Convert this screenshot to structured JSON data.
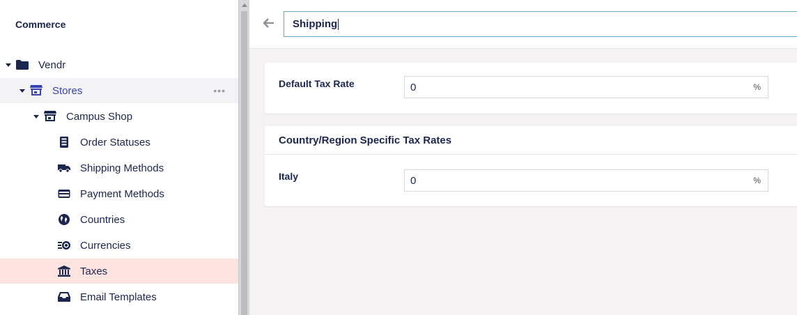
{
  "sidebar": {
    "section_title": "Commerce",
    "tree": [
      {
        "label": "Vendr",
        "icon": "folder-icon"
      },
      {
        "label": "Stores",
        "icon": "store-icon",
        "more": "•••"
      },
      {
        "label": "Campus Shop",
        "icon": "store-icon"
      },
      {
        "label": "Order Statuses",
        "icon": "clipboard-icon"
      },
      {
        "label": "Shipping Methods",
        "icon": "truck-icon"
      },
      {
        "label": "Payment Methods",
        "icon": "credit-card-icon"
      },
      {
        "label": "Countries",
        "icon": "globe-icon"
      },
      {
        "label": "Currencies",
        "icon": "coins-icon"
      },
      {
        "label": "Taxes",
        "icon": "bank-icon"
      },
      {
        "label": "Email Templates",
        "icon": "inbox-icon"
      }
    ]
  },
  "header": {
    "name_value": "Shipping"
  },
  "default_tax": {
    "label": "Default Tax Rate",
    "value": "0",
    "unit": "%"
  },
  "region_rates": {
    "title": "Country/Region Specific Tax Rates",
    "rows": [
      {
        "label": "Italy",
        "value": "0",
        "unit": "%"
      }
    ]
  },
  "colors": {
    "text": "#1b264f",
    "link_blue": "#3544b1",
    "active_bg": "#fde4e0",
    "input_focus": "#68a9cf"
  }
}
